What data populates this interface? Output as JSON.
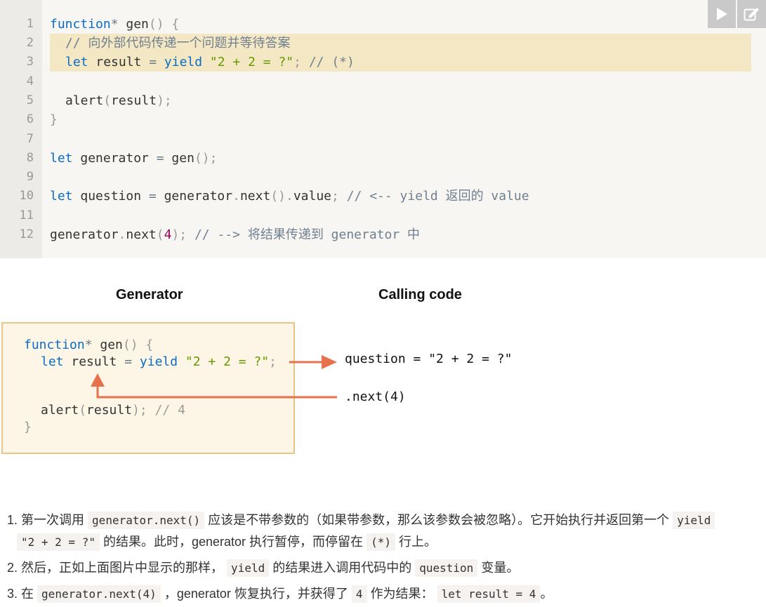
{
  "code_block": {
    "line_numbers": [
      "1",
      "2",
      "3",
      "4",
      "5",
      "6",
      "7",
      "8",
      "9",
      "10",
      "11",
      "12"
    ],
    "lines": {
      "l1": {
        "kw": "function",
        "star": "*",
        "name": " gen",
        "rest": "() {"
      },
      "l2": {
        "comment": "// 向外部代码传递一个问题并等待答案"
      },
      "l3": {
        "kw_let": "let",
        "var": " result ",
        "eq": "=",
        "kw_yield": " yield ",
        "str": "\"2 + 2 = ?\"",
        "semi": ";",
        "comment": " // (*)"
      },
      "l5": {
        "call": "alert",
        "p1": "(",
        "arg": "result",
        "p2": ");"
      },
      "l6": {
        "brace": "}"
      },
      "l8": {
        "kw_let": "let",
        "var": " generator ",
        "eq": "=",
        "call": " gen",
        "p": "();"
      },
      "l10": {
        "kw_let": "let",
        "var": " question ",
        "eq": "=",
        "obj": " generator",
        "dot1": ".",
        "m": "next",
        "p1": "().",
        "prop": "value",
        "semi": ";",
        "comment": " // <-- yield 返回的 value"
      },
      "l12": {
        "obj": "generator",
        "dot": ".",
        "m": "next",
        "p1": "(",
        "num": "4",
        "p2": ");",
        "comment": " // --> 将结果传递到 generator 中"
      }
    },
    "toolbar": {
      "run_icon": "play-icon",
      "edit_icon": "edit-icon"
    }
  },
  "diagram": {
    "left_title": "Generator",
    "right_title": "Calling code",
    "box_code": {
      "l1_kw": "function",
      "l1_star": "*",
      "l1_rest": " gen",
      "l1_paren": "() {",
      "l2_kw": "let",
      "l2_var": " result ",
      "l2_eq": "=",
      "l2_yield": " yield ",
      "l2_str": "\"2 + 2 = ?\"",
      "l2_semi": ";",
      "l3_call": "alert",
      "l3_p1": "(",
      "l3_arg": "result",
      "l3_p2": ");",
      "l3_comment": " // 4",
      "l4": "}"
    },
    "question_text": "question = \"2 + 2 = ?\"",
    "next_text": ".next(4)",
    "arrow_color": "#e8714d"
  },
  "list": {
    "item1": {
      "num": "1.",
      "t1": "第一次调用",
      "c1": "generator.next()",
      "t2": "应该是不带参数的（如果带参数，那么该参数会被忽略）。它开始执行并返回第一个",
      "c2": "yield",
      "c3": "\"2 + 2 = ?\"",
      "t3": "的结果。此时，generator 执行暂停，而停留在",
      "c4": "(*)",
      "t4": "行上。"
    },
    "item2": {
      "num": "2.",
      "t1": "然后，正如上面图片中显示的那样，",
      "c1": "yield",
      "t2": "的结果进入调用代码中的",
      "c2": "question",
      "t3": "变量。"
    },
    "item3": {
      "num": "3.",
      "t1": "在",
      "c1": "generator.next(4)",
      "t2": "，generator 恢复执行，并获得了",
      "c2": "4",
      "t3": "作为结果：",
      "c3": "let result = 4",
      "t4": "。"
    }
  }
}
